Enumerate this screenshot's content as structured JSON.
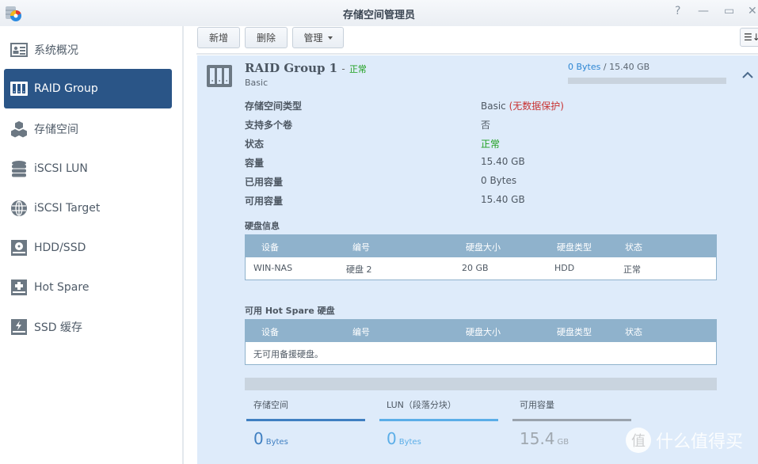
{
  "window": {
    "title": "存储空间管理员",
    "controls": {
      "help": "?",
      "minimize": "—",
      "maximize": "▭",
      "close": "✕"
    }
  },
  "sidebar": {
    "items": [
      {
        "label": "系统概况",
        "icon": "overview-icon",
        "active": false
      },
      {
        "label": "RAID Group",
        "icon": "raid-group-icon",
        "active": true
      },
      {
        "label": "存储空间",
        "icon": "storage-cubes-icon",
        "active": false
      },
      {
        "label": "iSCSI LUN",
        "icon": "database-icon",
        "active": false
      },
      {
        "label": "iSCSI Target",
        "icon": "globe-icon",
        "active": false
      },
      {
        "label": "HDD/SSD",
        "icon": "hdd-icon",
        "active": false
      },
      {
        "label": "Hot Spare",
        "icon": "hot-spare-icon",
        "active": false
      },
      {
        "label": "SSD 缓存",
        "icon": "ssd-cache-icon",
        "active": false
      }
    ]
  },
  "toolbar": {
    "create_label": "新增",
    "delete_label": "删除",
    "manage_label": "管理"
  },
  "raid": {
    "name": "RAID Group 1",
    "separator": "-",
    "status": "正常",
    "type": "Basic",
    "usage": {
      "used": "0 Bytes",
      "separator": " / ",
      "total": "15.40 GB",
      "used_fraction": 0
    },
    "properties": [
      {
        "label": "存储空间类型",
        "value": "Basic",
        "note": "(无数据保护)"
      },
      {
        "label": "支持多个卷",
        "value": "否"
      },
      {
        "label": "状态",
        "value": "正常"
      },
      {
        "label": "容量",
        "value": "15.40 GB"
      },
      {
        "label": "已用容量",
        "value": "0 Bytes"
      },
      {
        "label": "可用容量",
        "value": "15.40 GB"
      }
    ],
    "disk_info": {
      "title": "硬盘信息",
      "columns": [
        "设备",
        "编号",
        "硬盘大小",
        "硬盘类型",
        "状态"
      ],
      "rows": [
        [
          "WIN-NAS",
          "硬盘 2",
          "20 GB",
          "HDD",
          "正常"
        ]
      ]
    },
    "hot_spare": {
      "title": "可用 Hot Spare 硬盘",
      "columns": [
        "设备",
        "编号",
        "硬盘大小",
        "硬盘类型",
        "状态"
      ],
      "empty_message": "无可用备援硬盘。"
    },
    "stats": [
      {
        "label": "存储空间",
        "value": "0",
        "unit": "Bytes",
        "color": "#3f7fc1"
      },
      {
        "label": "LUN（段落分块）",
        "value": "0",
        "unit": "Bytes",
        "color": "#5baee8"
      },
      {
        "label": "可用容量",
        "value": "15.4",
        "unit": "GB",
        "color": "#a0a8b0"
      }
    ]
  },
  "watermark": {
    "badge": "值",
    "text": "什么值得买"
  },
  "colors": {
    "accent": "#2a5587",
    "panel_bg": "#deebfa",
    "table_header": "#8fb2cc",
    "status_ok": "#20a020",
    "warning_red": "#c83232"
  }
}
